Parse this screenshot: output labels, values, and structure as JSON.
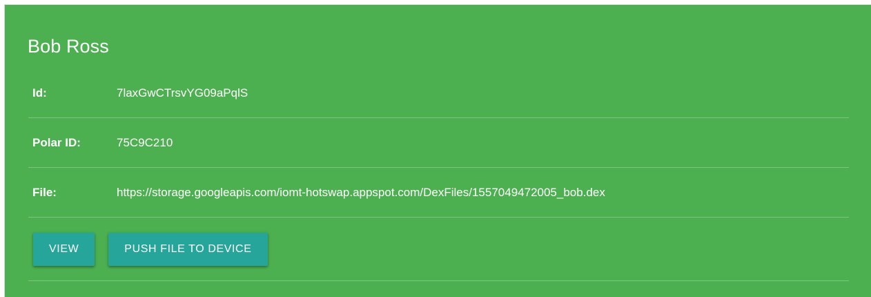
{
  "card": {
    "title": "Bob Ross",
    "background": "#4caf50",
    "rows": [
      {
        "label": "Id:",
        "value": "7laxGwCTrsvYG09aPqlS"
      },
      {
        "label": "Polar ID:",
        "value": "75C9C210"
      },
      {
        "label": "File:",
        "value": "https://storage.googleapis.com/iomt-hotswap.appspot.com/DexFiles/1557049472005_bob.dex"
      }
    ],
    "actions": {
      "view_label": "VIEW",
      "push_label": "PUSH FILE TO DEVICE",
      "button_color": "#26a69a"
    }
  }
}
